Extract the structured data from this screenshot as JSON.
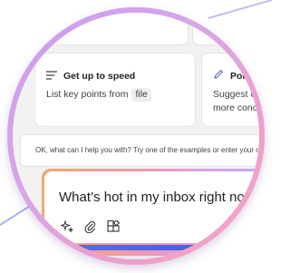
{
  "colors": {
    "ring_gradient": [
      "#c99cf5",
      "#d7a6e6",
      "#ef9fc9",
      "#f4a9c4"
    ],
    "accent": "#4a56d6",
    "input_border_gradient": [
      "#f0a96f",
      "#f29aa7",
      "#d6a0e8",
      "#b9b2f7"
    ],
    "text_primary": "#242424",
    "text_secondary": "#424242"
  },
  "cards": [
    {
      "icon": "list-lines-icon",
      "title": "Get up to speed",
      "body_text": "List key points from",
      "body_chip": "file"
    },
    {
      "icon": "pencil-icon",
      "title": "Polish",
      "body_line1": "Suggest edits",
      "body_line2": "more concise"
    }
  ],
  "hint": {
    "text": "OK, what can I help you with? Try one of the examples or enter your own"
  },
  "composer": {
    "value": "What’s hot in my inbox right now?",
    "icons": [
      "sparkle-icon",
      "paperclip-icon",
      "apps-grid-icon"
    ]
  }
}
